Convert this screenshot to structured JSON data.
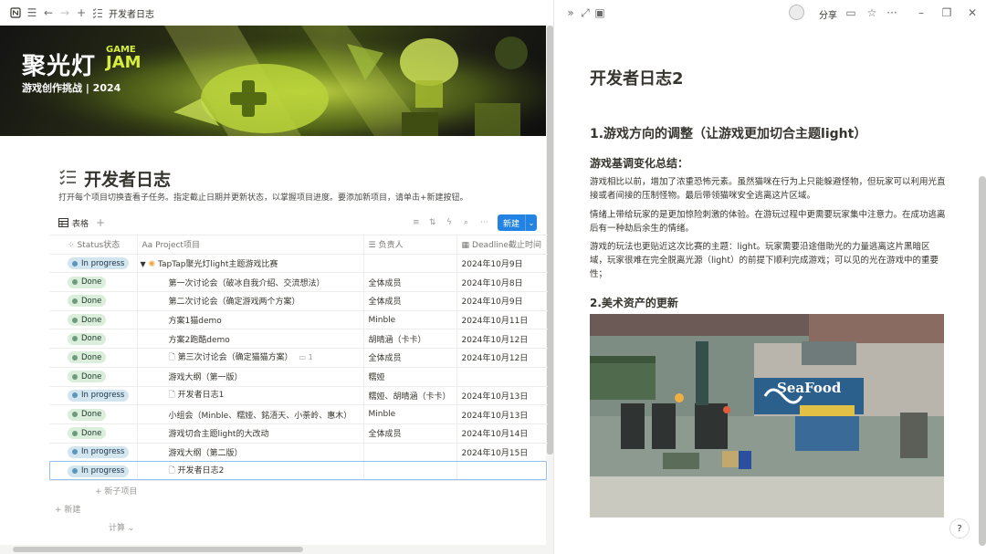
{
  "left_topbar": {
    "title": "开发者日志"
  },
  "banner": {
    "logo_line1": "聚光灯",
    "logo_game": "GAME",
    "logo_jam": "JAM",
    "logo_line2": "游戏创作挑战 | 2024"
  },
  "page": {
    "title": "开发者日志",
    "description": "打开每个项目切换查看子任务。指定截止日期并更新状态，以掌握项目进度。要添加新项目，请单击+新建按钮。"
  },
  "view": {
    "tab_label": "表格",
    "new_button": "新建"
  },
  "table": {
    "headers": [
      "Status状态",
      "Project项目",
      "负责人",
      "Deadline截止时间"
    ],
    "rows": [
      {
        "status": "In progress",
        "project": "TapTap聚光灯light主题游戏比赛",
        "owner": "",
        "deadline": "2024年10月9日"
      },
      {
        "status": "Done",
        "project": "第一次讨论会（破冰自我介绍、交流想法）",
        "owner": "全体成员",
        "deadline": "2024年10月8日"
      },
      {
        "status": "Done",
        "project": "第二次讨论会（确定游戏两个方案）",
        "owner": "全体成员",
        "deadline": "2024年10月9日"
      },
      {
        "status": "Done",
        "project": "方案1猫demo",
        "owner": "Minble",
        "deadline": "2024年10月11日"
      },
      {
        "status": "Done",
        "project": "方案2跑酷demo",
        "owner": "胡晴涵（卡卡）",
        "deadline": "2024年10月12日"
      },
      {
        "status": "Done",
        "project": "第三次讨论会（确定猫猫方案）",
        "owner": "全体成员",
        "deadline": "2024年10月12日",
        "comments": "1"
      },
      {
        "status": "Done",
        "project": "游戏大纲（第一版）",
        "owner": "糯娅",
        "deadline": ""
      },
      {
        "status": "In progress",
        "project": "开发者日志1",
        "owner": "糯娅、胡晴涵（卡卡）",
        "deadline": "2024年10月13日"
      },
      {
        "status": "Done",
        "project": "小组会（Minble、糯娅、銘浯天、小荼岭、惠木）",
        "owner": "Minble",
        "deadline": "2024年10月13日"
      },
      {
        "status": "Done",
        "project": "游戏切合主题light的大改动",
        "owner": "全体成员",
        "deadline": "2024年10月14日"
      },
      {
        "status": "In progress",
        "project": "游戏大纲（第二版）",
        "owner": "",
        "deadline": "2024年10月15日"
      },
      {
        "status": "In progress",
        "project": "开发者日志2",
        "owner": "",
        "deadline": ""
      }
    ],
    "add_subitem": "+ 新子项目",
    "add_new": "+ 新建",
    "calculate": "计算 ⌄"
  },
  "right_topbar": {
    "share": "分享"
  },
  "doc": {
    "title": "开发者日志2",
    "h2_1": "1.游戏方向的调整（让游戏更加切合主题light）",
    "h3_1": "游戏基调变化总结：",
    "p1": "游戏相比以前，增加了浓重恐怖元素。虽然猫咪在行为上只能躲避怪物，但玩家可以利用光直接或者间接的压制怪物。最后带领猫咪安全逃离这片区域。",
    "p2": "情绪上带给玩家的是更加惊险刺激的体验。在游玩过程中更需要玩家集中注意力。在成功逃离后有一种劫后余生的情绪。",
    "p3": "游戏的玩法也更贴近这次比赛的主题：light。玩家需要沿途借助光的力量逃离这片黑暗区域，玩家很难在完全脱离光源（light）的前提下顺利完成游戏；可以见的光在游戏中的重要性；",
    "h2_2": "2.美术资产的更新",
    "sign_text": "SeaFood"
  },
  "colors": {
    "accent": "#2383e2",
    "progress_pill": "#d3e5ef",
    "done_pill": "#dbeddb"
  }
}
